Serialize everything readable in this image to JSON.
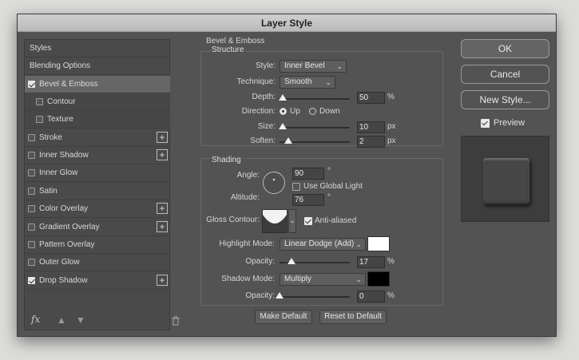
{
  "dialog": {
    "title": "Layer Style"
  },
  "styles_panel": {
    "items": [
      {
        "label": "Styles",
        "checkbox": false,
        "checked": false,
        "plus": false
      },
      {
        "label": "Blending Options",
        "checkbox": false,
        "checked": false,
        "plus": false
      },
      {
        "label": "Bevel & Emboss",
        "checkbox": true,
        "checked": true,
        "plus": false,
        "selected": true
      },
      {
        "label": "Contour",
        "checkbox": true,
        "checked": false,
        "plus": false,
        "sub": true
      },
      {
        "label": "Texture",
        "checkbox": true,
        "checked": false,
        "plus": false,
        "sub": true
      },
      {
        "label": "Stroke",
        "checkbox": true,
        "checked": false,
        "plus": true
      },
      {
        "label": "Inner Shadow",
        "checkbox": true,
        "checked": false,
        "plus": true
      },
      {
        "label": "Inner Glow",
        "checkbox": true,
        "checked": false,
        "plus": false
      },
      {
        "label": "Satin",
        "checkbox": true,
        "checked": false,
        "plus": false
      },
      {
        "label": "Color Overlay",
        "checkbox": true,
        "checked": false,
        "plus": true
      },
      {
        "label": "Gradient Overlay",
        "checkbox": true,
        "checked": false,
        "plus": true
      },
      {
        "label": "Pattern Overlay",
        "checkbox": true,
        "checked": false,
        "plus": false
      },
      {
        "label": "Outer Glow",
        "checkbox": true,
        "checked": false,
        "plus": false
      },
      {
        "label": "Drop Shadow",
        "checkbox": true,
        "checked": true,
        "plus": true
      }
    ],
    "plus_symbol": "+",
    "footer": {
      "fx_label": "fx",
      "up_icon": "arrow-up-icon",
      "down_icon": "arrow-down-icon",
      "trash_icon": "trash-icon"
    }
  },
  "bevel_emboss": {
    "title": "Bevel & Emboss",
    "structure": {
      "title": "Structure",
      "style_label": "Style:",
      "style_value": "Inner Bevel",
      "technique_label": "Technique:",
      "technique_value": "Smooth",
      "depth_label": "Depth:",
      "depth_value": "50",
      "depth_unit": "%",
      "depth_fraction": 0.05,
      "direction_label": "Direction:",
      "direction_up": "Up",
      "direction_down": "Down",
      "direction_selected": "Up",
      "size_label": "Size:",
      "size_value": "10",
      "size_unit": "px",
      "size_fraction": 0.04,
      "soften_label": "Soften:",
      "soften_value": "2",
      "soften_unit": "px",
      "soften_fraction": 0.125
    },
    "shading": {
      "title": "Shading",
      "angle_label": "Angle:",
      "angle_value": "90",
      "angle_unit": "°",
      "global_light_label": "Use Global Light",
      "global_light_checked": false,
      "altitude_label": "Altitude:",
      "altitude_value": "76",
      "altitude_unit": "°",
      "gloss_contour_label": "Gloss Contour:",
      "anti_aliased_label": "Anti-aliased",
      "anti_aliased_checked": true,
      "highlight_mode_label": "Highlight Mode:",
      "highlight_mode_value": "Linear Dodge (Add)",
      "highlight_color": "#ffffff",
      "highlight_opacity_label": "Opacity:",
      "highlight_opacity_value": "17",
      "highlight_opacity_unit": "%",
      "highlight_opacity_fraction": 0.17,
      "shadow_mode_label": "Shadow Mode:",
      "shadow_mode_value": "Multiply",
      "shadow_color": "#000000",
      "shadow_opacity_label": "Opacity:",
      "shadow_opacity_value": "0",
      "shadow_opacity_unit": "%",
      "shadow_opacity_fraction": 0.0
    },
    "make_default": "Make Default",
    "reset_default": "Reset to Default"
  },
  "right": {
    "ok": "OK",
    "cancel": "Cancel",
    "new_style": "New Style...",
    "preview_label": "Preview",
    "preview_checked": true
  }
}
